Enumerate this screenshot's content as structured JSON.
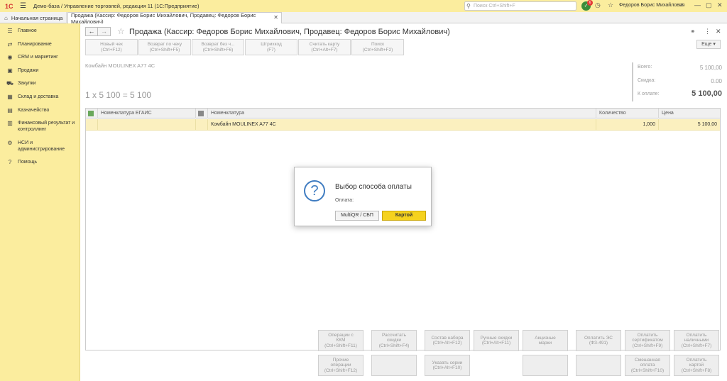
{
  "titlebar": {
    "logo": "1С",
    "app_title": "Демо-база / Управление торговлей, редакция 11  (1С:Предприятие)",
    "search_placeholder": "Поиск Ctrl+Shift+F",
    "notif_count": "6",
    "user": "Федоров Борис Михайлович"
  },
  "tabs": {
    "home": "Начальная страница",
    "active": "Продажа (Кассир: Федоров Борис Михайлович, Продавец: Федоров Борис Михайлович)"
  },
  "sidebar": {
    "items": [
      {
        "label": "Главное",
        "icon": "menu-icon"
      },
      {
        "label": "Планирование",
        "icon": "planning-icon"
      },
      {
        "label": "CRM и маркетинг",
        "icon": "crm-icon"
      },
      {
        "label": "Продажи",
        "icon": "sales-icon"
      },
      {
        "label": "Закупки",
        "icon": "purchases-icon"
      },
      {
        "label": "Склад и доставка",
        "icon": "warehouse-icon"
      },
      {
        "label": "Казначейство",
        "icon": "treasury-icon"
      },
      {
        "label": "Финансовый результат и контроллинг",
        "icon": "finance-icon"
      },
      {
        "label": "НСИ и администрирование",
        "icon": "settings-icon"
      },
      {
        "label": "Помощь",
        "icon": "help-icon"
      }
    ]
  },
  "form": {
    "title": "Продажа (Кассир: Федоров Борис Михайлович, Продавец: Федоров Борис Михайлович)",
    "more_label": "Еще ▾",
    "toolbar": [
      {
        "l1": "Новый чек",
        "l2": "(Ctrl+F12)"
      },
      {
        "l1": "Возврат по чеку",
        "l2": "(Ctrl+Shift+F5)"
      },
      {
        "l1": "Возврат без ч...",
        "l2": "(Ctrl+Shift+F6)"
      },
      {
        "l1": "Штрихкод",
        "l2": "(F7)"
      },
      {
        "l1": "Считать карту",
        "l2": "(Ctrl+Alt+F7)"
      },
      {
        "l1": "Поиск",
        "l2": "(Ctrl+Shift+F2)"
      }
    ],
    "product_label": "Комбайн MOULINEX  A77 4C",
    "calc_line": "1 x 5 100 = 5 100"
  },
  "totals": {
    "total_label": "Всего:",
    "total_value": "5 100,00",
    "discount_label": "Скидка:",
    "discount_value": "0.00",
    "pay_label": "К оплате:",
    "pay_value": "5 100,00"
  },
  "grid": {
    "headers": {
      "egais": "Номенклатура ЕГАИС",
      "nom": "Номенклатура",
      "qty": "Количество",
      "price": "Цена"
    },
    "rows": [
      {
        "egais": "",
        "nom": "Комбайн MOULINEX  A77 4C",
        "qty": "1,000",
        "price": "5 100,00"
      }
    ]
  },
  "bottom": {
    "row1": [
      {
        "l1": "Операции с",
        "l2": "ККМ",
        "l3": "(Ctrl+Shift+F11)"
      },
      {
        "l1": "Рассчитать",
        "l2": "скидки",
        "l3": "(Ctrl+Shift+F4)"
      },
      {
        "l1": "Состав набора",
        "l2": "(Ctrl+Alt+F12)",
        "l3": ""
      },
      {
        "l1": "Ручные скидки",
        "l2": "(Ctrl+Alt+F11)",
        "l3": ""
      },
      {
        "l1": "Акцизные",
        "l2": "марки",
        "l3": ""
      },
      {
        "l1": "Оплатить ЭС",
        "l2": "(ФЗ-491)",
        "l3": ""
      },
      {
        "l1": "Оплатить",
        "l2": "сертификатом",
        "l3": "(Ctrl+Shift+F9)"
      },
      {
        "l1": "Оплатить",
        "l2": "наличными",
        "l3": "(Ctrl+Shift+F7)"
      }
    ],
    "row2": [
      {
        "l1": "Прочие",
        "l2": "операции",
        "l3": "(Ctrl+Shift+F12)"
      },
      {
        "l1": "",
        "l2": "",
        "l3": ""
      },
      {
        "l1": "Указать серии",
        "l2": "(Ctrl+Alt+F10)",
        "l3": ""
      },
      {
        "l1": "",
        "l2": "",
        "l3": ""
      },
      {
        "l1": "",
        "l2": "",
        "l3": ""
      },
      {
        "l1": "",
        "l2": "",
        "l3": ""
      },
      {
        "l1": "Смешанная",
        "l2": "оплата",
        "l3": "(Ctrl+Shift+F10)"
      },
      {
        "l1": "Оплатить",
        "l2": "картой",
        "l3": "(Ctrl+Shift+F8)"
      }
    ]
  },
  "modal": {
    "title": "Выбор способа оплаты",
    "label": "Оплата:",
    "btn1": "MultiQR / СБП",
    "btn2": "Картой"
  }
}
